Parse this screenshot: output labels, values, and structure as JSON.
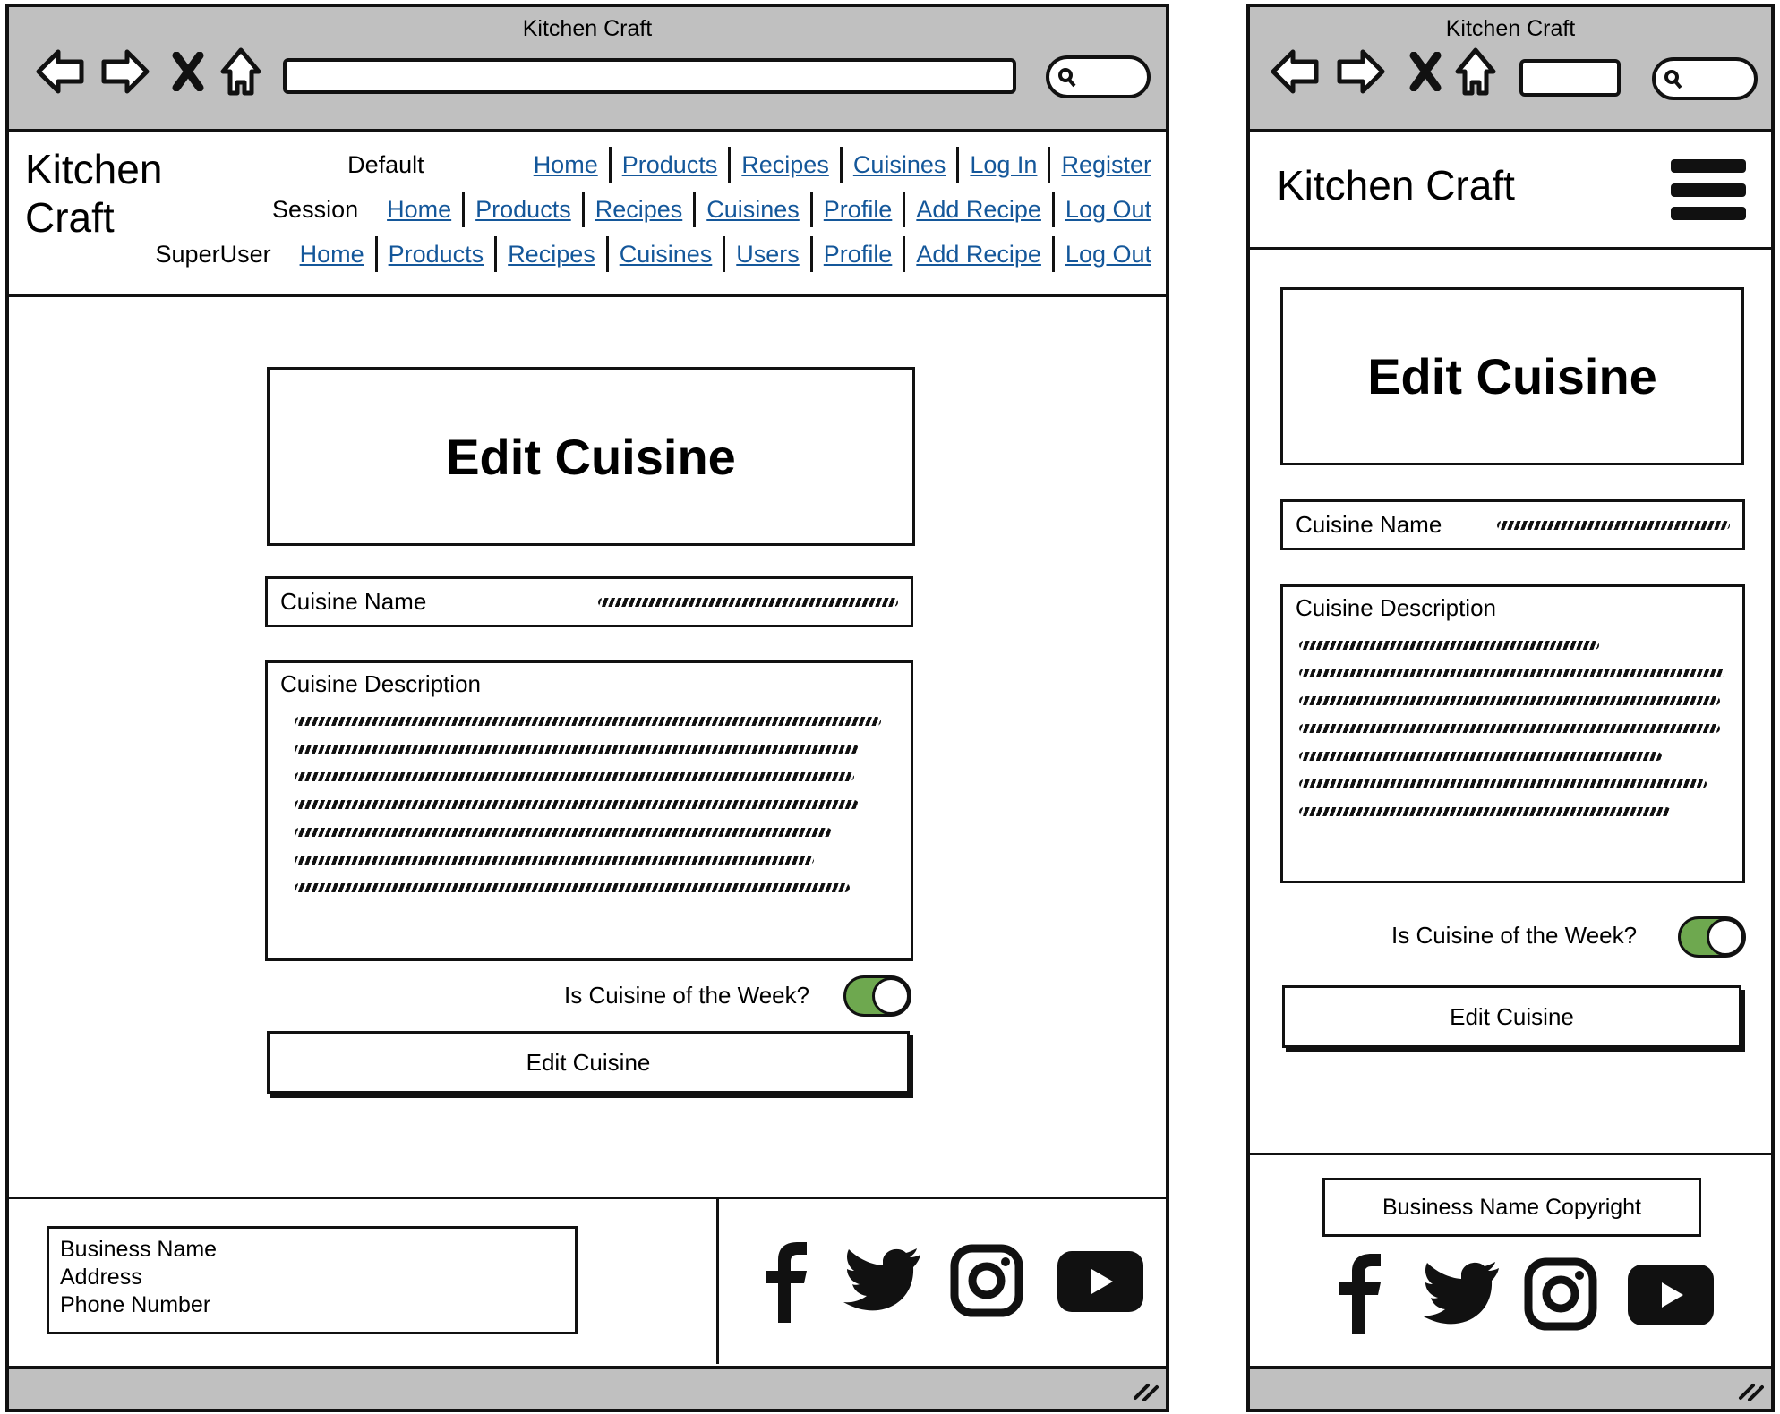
{
  "window_title": "Kitchen Craft",
  "desktop": {
    "brand": "Kitchen Craft",
    "nav_rows": [
      {
        "label": "Default",
        "links": [
          "Home",
          "Products",
          "Recipes",
          "Cuisines",
          "Log In",
          "Register"
        ]
      },
      {
        "label": "Session",
        "links": [
          "Home",
          "Products",
          "Recipes",
          "Cuisines",
          "Profile",
          "Add Recipe",
          "Log Out"
        ]
      },
      {
        "label": "SuperUser",
        "links": [
          "Home",
          "Products",
          "Recipes",
          "Cuisines",
          "Users",
          "Profile",
          "Add Recipe",
          "Log Out"
        ]
      }
    ],
    "page_title": "Edit Cuisine",
    "cuisine_name_label": "Cuisine Name",
    "cuisine_description_label": "Cuisine Description",
    "cuisine_of_week_label": "Is Cuisine of the Week?",
    "cuisine_of_week_on": true,
    "submit_label": "Edit Cuisine",
    "footer": {
      "business_name": "Business Name",
      "address": "Address",
      "phone": "Phone Number"
    }
  },
  "mobile": {
    "brand": "Kitchen Craft",
    "page_title": "Edit Cuisine",
    "cuisine_name_label": "Cuisine Name",
    "cuisine_description_label": "Cuisine Description",
    "cuisine_of_week_label": "Is Cuisine of the Week?",
    "cuisine_of_week_on": true,
    "submit_label": "Edit Cuisine",
    "copyright": "Business Name Copyright"
  },
  "social_icons": [
    "facebook-icon",
    "twitter-icon",
    "instagram-icon",
    "youtube-icon"
  ],
  "colors": {
    "link": "#14579a",
    "toggle_on": "#6ea84f",
    "chrome": "#c0c0c0"
  }
}
